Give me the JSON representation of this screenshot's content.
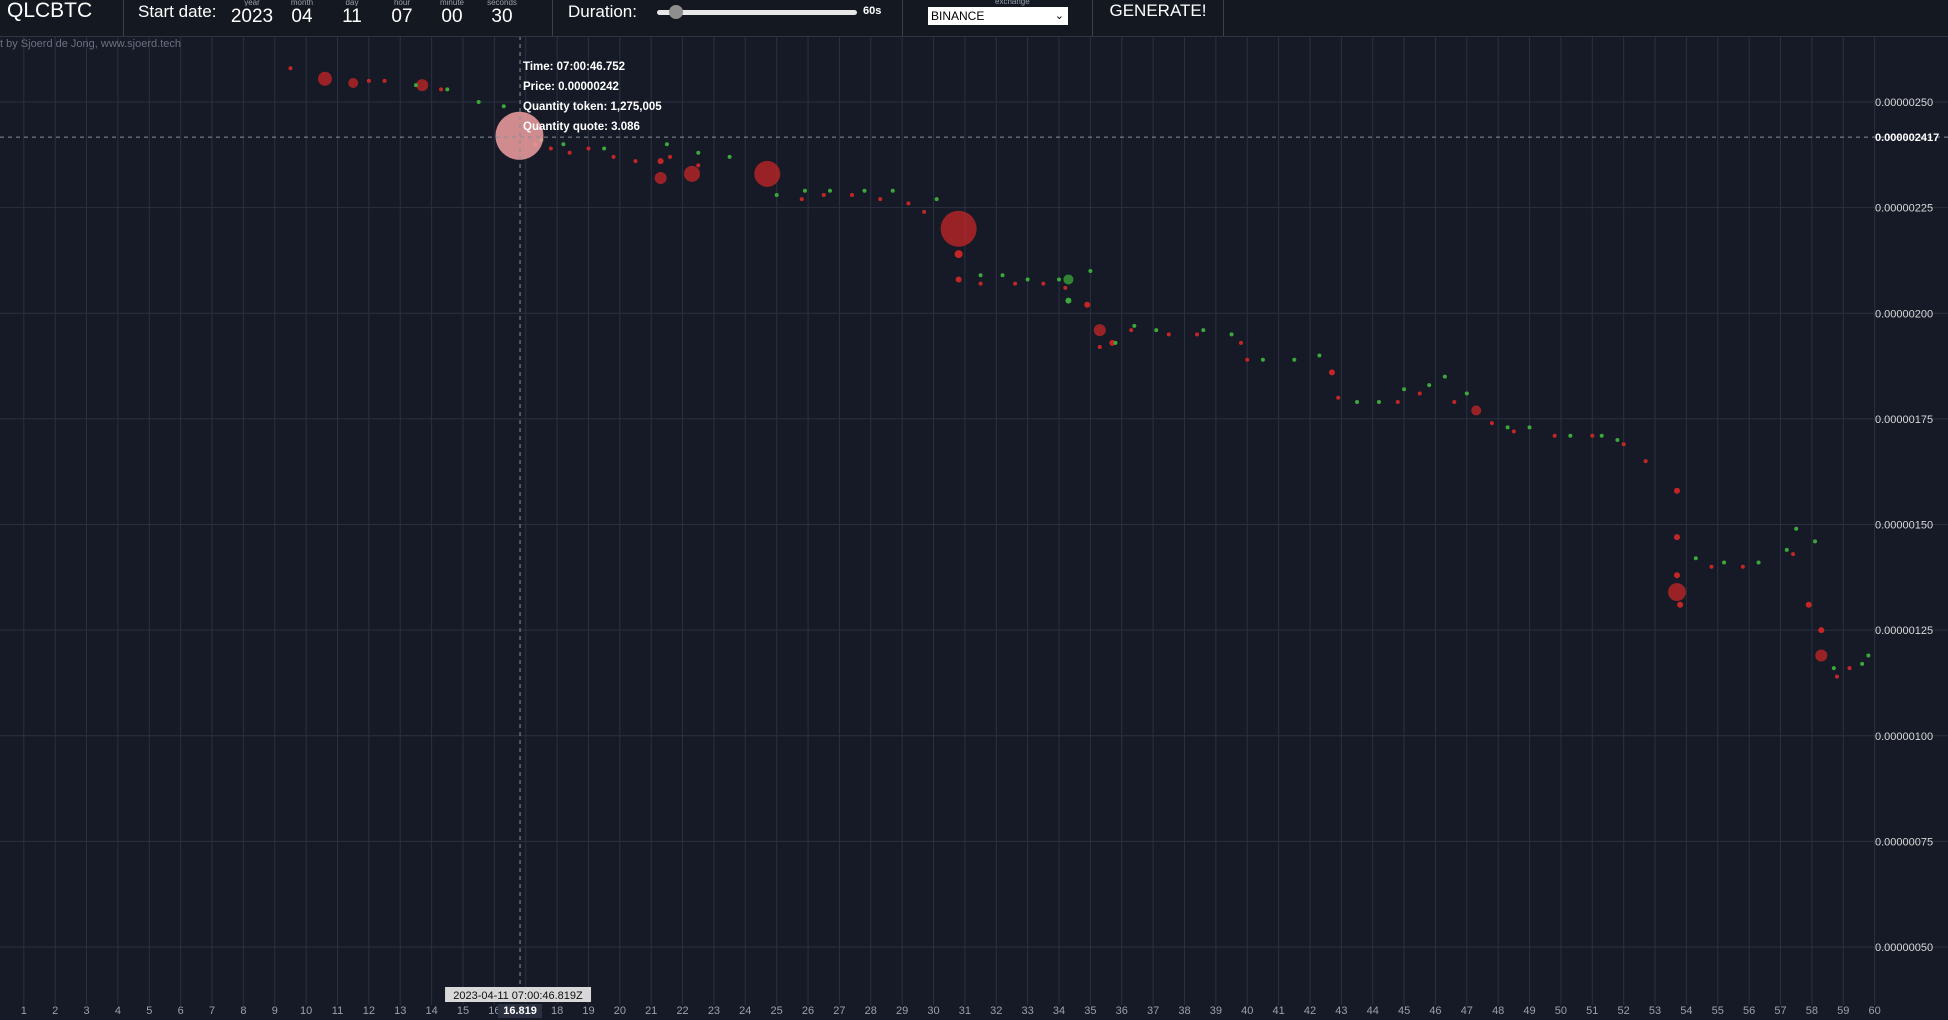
{
  "header": {
    "symbol": "QLCBTC",
    "start_label": "Start date:",
    "date_fields": [
      {
        "label": "year",
        "value": "2023"
      },
      {
        "label": "month",
        "value": "04"
      },
      {
        "label": "day",
        "value": "11"
      },
      {
        "label": "hour",
        "value": "07"
      },
      {
        "label": "minute",
        "value": "00"
      },
      {
        "label": "seconds",
        "value": "30"
      }
    ],
    "duration_label": "Duration:",
    "duration_value": "60s",
    "duration_fraction": 0.03,
    "exchange_label": "exchange",
    "exchange_value": "BINANCE",
    "generate_label": "GENERATE!"
  },
  "credit": "t by Sjoerd de Jong, www.sjoerd.tech",
  "tooltip": {
    "time": "Time: 07:00:46.752",
    "price": "Price: 0.00000242",
    "qty_token": "Quantity token: 1,275,005",
    "qty_quote": "Quantity quote: 3.086"
  },
  "crosshair": {
    "price_label": "0.000002417",
    "price": 2.417e-06,
    "time_label": "2023-04-11 07:00:46.819Z",
    "x_label": "16.819",
    "x": 16.819
  },
  "colors": {
    "buy": "#3aa83a",
    "sell": "#c42626",
    "grid": "#2b3040",
    "background": "#161a26"
  },
  "chart_data": {
    "type": "scatter",
    "x_ticks": [
      1,
      2,
      3,
      4,
      5,
      6,
      7,
      8,
      9,
      10,
      11,
      12,
      13,
      14,
      15,
      16,
      17,
      18,
      19,
      20,
      21,
      22,
      23,
      24,
      25,
      26,
      27,
      28,
      29,
      30,
      31,
      32,
      33,
      34,
      35,
      36,
      37,
      38,
      39,
      40,
      41,
      42,
      43,
      44,
      45,
      46,
      47,
      48,
      49,
      50,
      51,
      52,
      53,
      54,
      55,
      56,
      57,
      58,
      59,
      60
    ],
    "xlim": [
      0.25,
      60
    ],
    "y_ticks": [
      "0.00000250",
      "0.00000225",
      "0.00000200",
      "0.00000175",
      "0.00000150",
      "0.00000125",
      "0.00000100",
      "0.00000075",
      "0.00000050"
    ],
    "ylim": [
      4.5e-07,
      2.65e-06
    ],
    "grid": true,
    "series": [
      {
        "side": "sell",
        "points": [
          [
            9.5,
            2.58,
            2
          ],
          [
            10.6,
            2.555,
            7
          ],
          [
            11.5,
            2.545,
            5
          ],
          [
            12,
            2.55,
            2
          ],
          [
            12.5,
            2.55,
            2
          ],
          [
            13.7,
            2.54,
            6
          ],
          [
            14.3,
            2.53,
            2
          ],
          [
            17.3,
            2.4,
            2
          ],
          [
            17.8,
            2.39,
            2
          ],
          [
            18.4,
            2.38,
            2
          ],
          [
            19,
            2.39,
            2
          ],
          [
            19.8,
            2.37,
            2
          ],
          [
            20.5,
            2.36,
            2
          ],
          [
            21.3,
            2.32,
            6
          ],
          [
            21.3,
            2.36,
            3
          ],
          [
            21.6,
            2.37,
            2
          ],
          [
            22.3,
            2.33,
            8
          ],
          [
            22.5,
            2.35,
            2
          ],
          [
            24.7,
            2.33,
            13
          ],
          [
            25.8,
            2.27,
            2
          ],
          [
            26.5,
            2.28,
            2
          ],
          [
            27.4,
            2.28,
            2
          ],
          [
            28.3,
            2.27,
            2
          ],
          [
            29.2,
            2.26,
            2
          ],
          [
            29.7,
            2.24,
            2
          ],
          [
            30.8,
            2.2,
            18
          ],
          [
            30.8,
            2.14,
            4
          ],
          [
            30.8,
            2.08,
            3
          ],
          [
            31.5,
            2.07,
            2
          ],
          [
            32.6,
            2.07,
            2
          ],
          [
            33.5,
            2.07,
            2
          ],
          [
            34.2,
            2.06,
            2
          ],
          [
            34.9,
            2.02,
            3
          ],
          [
            35.3,
            1.96,
            6
          ],
          [
            35.3,
            1.92,
            2
          ],
          [
            35.7,
            1.93,
            3
          ],
          [
            36.3,
            1.96,
            2
          ],
          [
            37.5,
            1.95,
            2
          ],
          [
            38.4,
            1.95,
            2
          ],
          [
            39.8,
            1.93,
            2
          ],
          [
            40,
            1.89,
            2
          ],
          [
            42.7,
            1.86,
            3
          ],
          [
            42.9,
            1.8,
            2
          ],
          [
            44.8,
            1.79,
            2
          ],
          [
            45.5,
            1.81,
            2
          ],
          [
            46.6,
            1.79,
            2
          ],
          [
            47.3,
            1.77,
            5
          ],
          [
            47.8,
            1.74,
            2
          ],
          [
            48.5,
            1.72,
            2
          ],
          [
            49.8,
            1.71,
            2
          ],
          [
            51,
            1.71,
            2
          ],
          [
            52,
            1.69,
            2
          ],
          [
            52.7,
            1.65,
            2
          ],
          [
            53.7,
            1.58,
            3
          ],
          [
            53.7,
            1.47,
            3
          ],
          [
            53.7,
            1.38,
            3
          ],
          [
            53.7,
            1.34,
            9
          ],
          [
            53.8,
            1.31,
            3
          ],
          [
            54.8,
            1.4,
            2
          ],
          [
            55.8,
            1.4,
            2
          ],
          [
            57.4,
            1.43,
            2
          ],
          [
            57.9,
            1.31,
            3
          ],
          [
            58.3,
            1.25,
            3
          ],
          [
            58.3,
            1.19,
            6
          ],
          [
            58.8,
            1.14,
            2
          ],
          [
            59.2,
            1.16,
            2
          ]
        ]
      },
      {
        "side": "buy",
        "points": [
          [
            13.5,
            2.54,
            2
          ],
          [
            14.5,
            2.53,
            2
          ],
          [
            15.5,
            2.5,
            2
          ],
          [
            16.3,
            2.49,
            2
          ],
          [
            17.5,
            2.41,
            2
          ],
          [
            18.2,
            2.4,
            2
          ],
          [
            19.5,
            2.39,
            2
          ],
          [
            21.5,
            2.4,
            2
          ],
          [
            22.5,
            2.38,
            2
          ],
          [
            23.5,
            2.37,
            2
          ],
          [
            25,
            2.28,
            2
          ],
          [
            25.9,
            2.29,
            2
          ],
          [
            26.7,
            2.29,
            2
          ],
          [
            27.8,
            2.29,
            2
          ],
          [
            28.7,
            2.29,
            2
          ],
          [
            30.1,
            2.27,
            2
          ],
          [
            31.5,
            2.09,
            2
          ],
          [
            32.2,
            2.09,
            2
          ],
          [
            33,
            2.08,
            2
          ],
          [
            34,
            2.08,
            2
          ],
          [
            34.3,
            2.08,
            5
          ],
          [
            34.3,
            2.03,
            3
          ],
          [
            35,
            2.1,
            2
          ],
          [
            35.8,
            1.93,
            2
          ],
          [
            36.4,
            1.97,
            2
          ],
          [
            37.1,
            1.96,
            2
          ],
          [
            38.6,
            1.96,
            2
          ],
          [
            39.5,
            1.95,
            2
          ],
          [
            40.5,
            1.89,
            2
          ],
          [
            41.5,
            1.89,
            2
          ],
          [
            42.3,
            1.9,
            2
          ],
          [
            43.5,
            1.79,
            2
          ],
          [
            44.2,
            1.79,
            2
          ],
          [
            45,
            1.82,
            2
          ],
          [
            45.8,
            1.83,
            2
          ],
          [
            46.3,
            1.85,
            2
          ],
          [
            47,
            1.81,
            2
          ],
          [
            48.3,
            1.73,
            2
          ],
          [
            49,
            1.73,
            2
          ],
          [
            50.3,
            1.71,
            2
          ],
          [
            51.3,
            1.71,
            2
          ],
          [
            51.8,
            1.7,
            2
          ],
          [
            54.3,
            1.42,
            2
          ],
          [
            55.2,
            1.41,
            2
          ],
          [
            56.3,
            1.41,
            2
          ],
          [
            57.2,
            1.44,
            2
          ],
          [
            57.5,
            1.49,
            2
          ],
          [
            58.1,
            1.46,
            2
          ],
          [
            58.7,
            1.16,
            2
          ],
          [
            59.6,
            1.17,
            2
          ],
          [
            59.8,
            1.19,
            2
          ]
        ]
      },
      {
        "side": "highlight",
        "points": [
          [
            16.8,
            2.42,
            24
          ]
        ]
      }
    ]
  }
}
